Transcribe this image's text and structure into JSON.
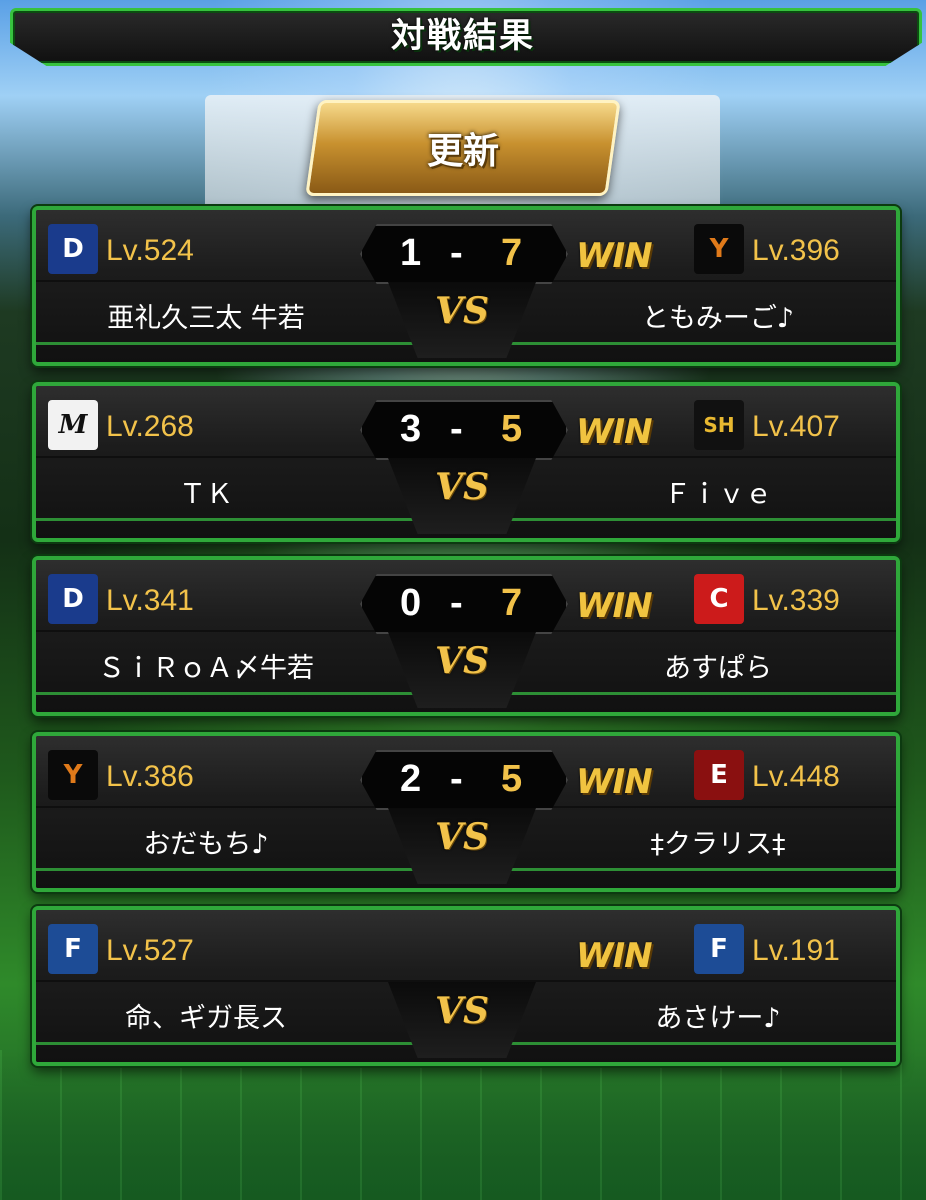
{
  "title": "対戦結果",
  "refresh_label": "更新",
  "vs_label": "VS",
  "win_label": "WIN",
  "matches": [
    {
      "left": {
        "icon": "dragons-icon",
        "icon_text": "D",
        "level": "Lv.524",
        "name": "亜礼久三太 牛若"
      },
      "right": {
        "icon": "giants-icon",
        "icon_text": "Y",
        "level": "Lv.396",
        "name": "ともみーご♪"
      },
      "score_left": "1",
      "score_dash": "-",
      "score_right": "7",
      "winner": "right"
    },
    {
      "left": {
        "icon": "marines-icon",
        "icon_text": "M",
        "level": "Lv.268",
        "name": "ＴＫ"
      },
      "right": {
        "icon": "hawks-icon",
        "icon_text": "SH",
        "level": "Lv.407",
        "name": "Ｆｉｖｅ"
      },
      "score_left": "3",
      "score_dash": "-",
      "score_right": "5",
      "winner": "right"
    },
    {
      "left": {
        "icon": "dragons-icon",
        "icon_text": "D",
        "level": "Lv.341",
        "name": "ＳｉＲｏＡ〆牛若"
      },
      "right": {
        "icon": "carp-icon",
        "icon_text": "C",
        "level": "Lv.339",
        "name": "あすぱら"
      },
      "score_left": "0",
      "score_dash": "-",
      "score_right": "7",
      "winner": "right"
    },
    {
      "left": {
        "icon": "giants-icon",
        "icon_text": "Y",
        "level": "Lv.386",
        "name": "おだもち♪"
      },
      "right": {
        "icon": "eagles-icon",
        "icon_text": "E",
        "level": "Lv.448",
        "name": "‡クラリス‡"
      },
      "score_left": "2",
      "score_dash": "-",
      "score_right": "5",
      "winner": "right"
    },
    {
      "left": {
        "icon": "fighters-icon",
        "icon_text": "F",
        "level": "Lv.527",
        "name": "命、ギガ長ス"
      },
      "right": {
        "icon": "fighters-icon",
        "icon_text": "F",
        "level": "Lv.191",
        "name": "あさけー♪"
      },
      "score_left": "",
      "score_dash": "",
      "score_right": "",
      "winner": "right"
    }
  ],
  "colors": {
    "accent_green": "#2fa83a",
    "gold": "#f2c24a",
    "card_bg": "#1a1a1a"
  }
}
